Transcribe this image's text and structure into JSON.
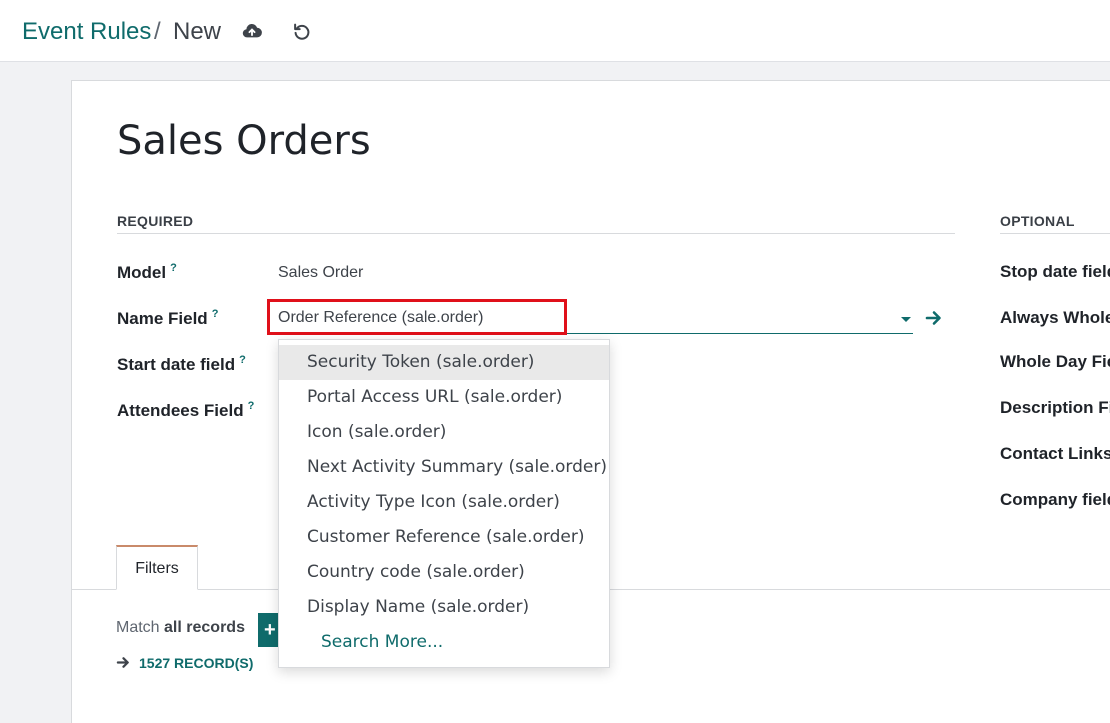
{
  "breadcrumb": {
    "root": "Event Rules",
    "separator": "/",
    "current": "New"
  },
  "toolbar": {
    "save_icon": "cloud-upload-icon",
    "discard_icon": "undo-icon"
  },
  "form": {
    "title": "Sales Orders",
    "required_section": "REQUIRED",
    "optional_section": "OPTIONAL",
    "required_fields": [
      {
        "label": "Model",
        "help": "?"
      },
      {
        "label": "Name Field",
        "help": "?"
      },
      {
        "label": "Start date field",
        "help": "?"
      },
      {
        "label": "Attendees Field",
        "help": "?"
      }
    ],
    "model_value": "Sales Order",
    "name_field_value": "Order Reference (sale.order)",
    "optional_fields": [
      "Stop date field",
      "Always Whole",
      "Whole Day Fie",
      "Description Fi",
      "Contact Links",
      "Company field"
    ]
  },
  "dropdown": {
    "items": [
      "Security Token (sale.order)",
      "Portal Access URL (sale.order)",
      "Icon (sale.order)",
      "Next Activity Summary (sale.order)",
      "Activity Type Icon (sale.order)",
      "Customer Reference (sale.order)",
      "Country code (sale.order)",
      "Display Name (sale.order)"
    ],
    "search_more": "Search More..."
  },
  "tabs": {
    "filters": "Filters"
  },
  "filters": {
    "match_prefix": "Match",
    "match_bold": "all records",
    "add_label": "+",
    "records_count": "1527 RECORD(S)"
  },
  "colors": {
    "accent": "#0f6b6b",
    "highlight_box": "#e0101a"
  }
}
